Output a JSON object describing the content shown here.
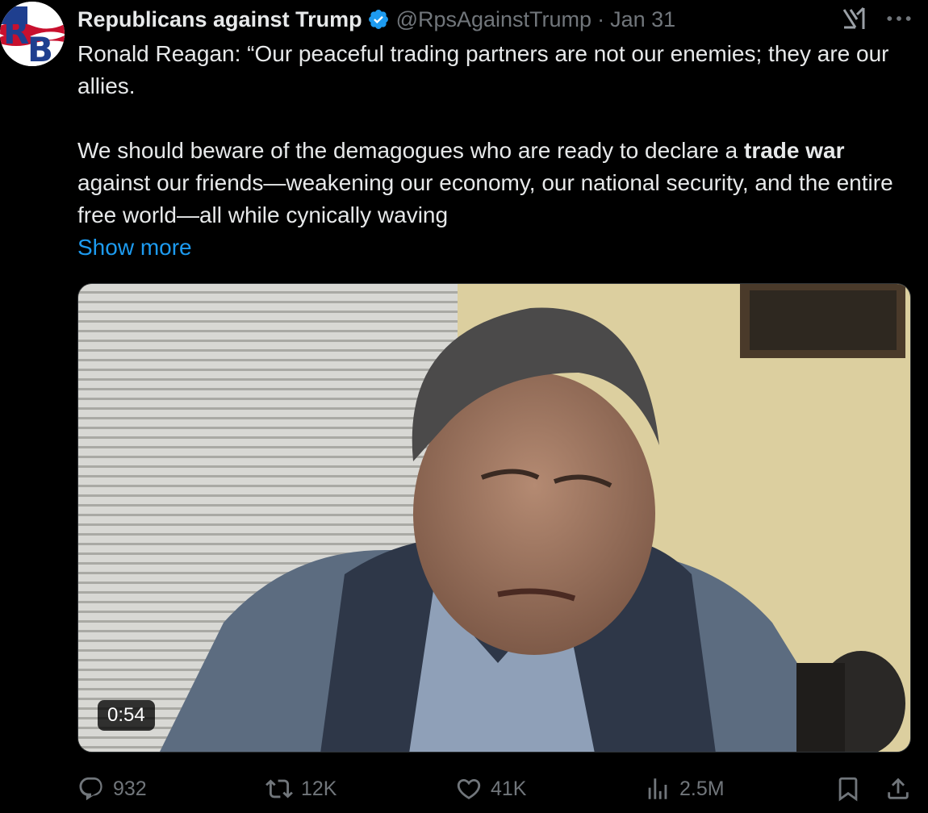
{
  "author": {
    "name": "Republicans against Trump",
    "handle": "@RpsAgainstTrump",
    "separator": "·",
    "date": "Jan 31",
    "avatar_text": "RB",
    "verified_color": "#1d9bf0"
  },
  "tweet": {
    "paragraph1": "Ronald Reagan: “Our peaceful trading partners are not our enemies; they are our allies.",
    "paragraph2_before": "We should beware of the demagogues who are ready to declare a ",
    "paragraph2_bold": "trade war",
    "paragraph2_after": " against our friends—weakening our economy, our national security, and the entire free world—all while cynically waving",
    "show_more": "Show more"
  },
  "media": {
    "duration": "0:54"
  },
  "actions": {
    "replies": "932",
    "reposts": "12K",
    "likes": "41K",
    "views": "2.5M"
  },
  "colors": {
    "background": "#000000",
    "text": "#e7e9ea",
    "secondary": "#71767b",
    "link": "#1d9bf0"
  },
  "icons": [
    "grok-icon",
    "more-icon",
    "reply-icon",
    "repost-icon",
    "like-icon",
    "views-icon",
    "bookmark-icon",
    "share-icon"
  ]
}
